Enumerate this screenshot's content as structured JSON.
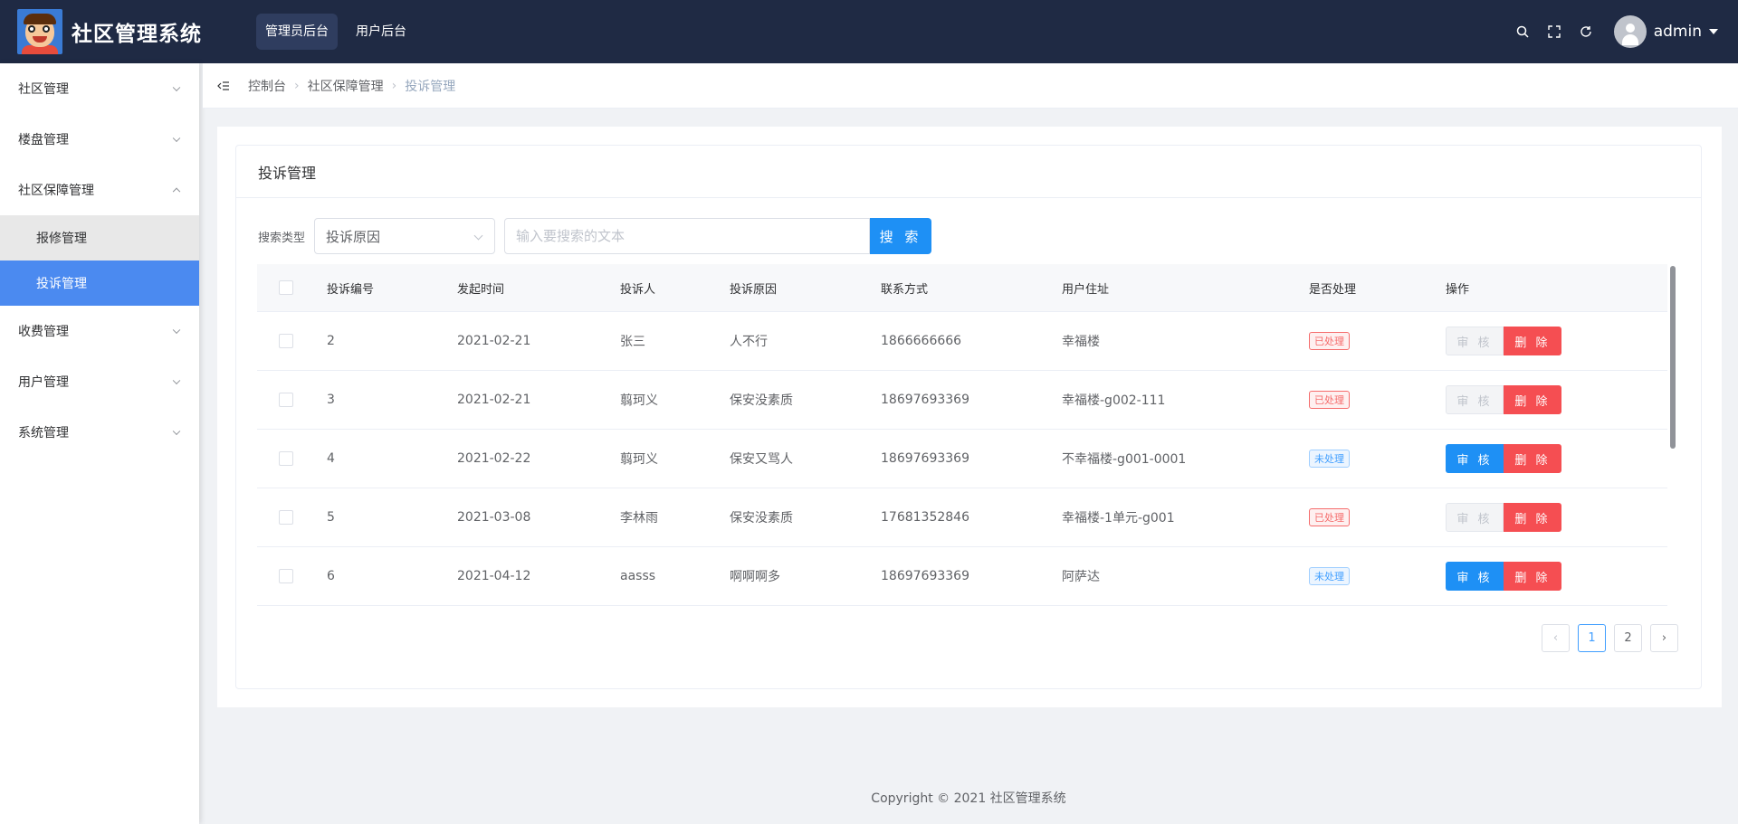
{
  "header": {
    "app_title": "社区管理系统",
    "nav": [
      {
        "label": "管理员后台",
        "active": true
      },
      {
        "label": "用户后台",
        "active": false
      }
    ],
    "tools": [
      "search-icon",
      "fullscreen-icon",
      "refresh-icon"
    ],
    "user_name": "admin",
    "background": "#1f2a44"
  },
  "sidebar": {
    "items": [
      {
        "label": "社区管理",
        "expanded": false
      },
      {
        "label": "楼盘管理",
        "expanded": false
      },
      {
        "label": "社区保障管理",
        "expanded": true,
        "children": [
          {
            "label": "报修管理",
            "active": false
          },
          {
            "label": "投诉管理",
            "active": true
          }
        ]
      },
      {
        "label": "收费管理",
        "expanded": false
      },
      {
        "label": "用户管理",
        "expanded": false
      },
      {
        "label": "系统管理",
        "expanded": false
      }
    ],
    "active_color": "#4b8af0"
  },
  "breadcrumb": [
    "控制台",
    "社区保障管理",
    "投诉管理"
  ],
  "card": {
    "title": "投诉管理"
  },
  "search": {
    "label": "搜索类型",
    "type_value": "投诉原因",
    "placeholder": "输入要搜索的文本",
    "button": "搜 索"
  },
  "table": {
    "columns": [
      "投诉编号",
      "发起时间",
      "投诉人",
      "投诉原因",
      "联系方式",
      "用户住址",
      "是否处理",
      "操作"
    ],
    "rows": [
      {
        "id": "2",
        "time": "2021-02-21",
        "user": "张三",
        "reason": "人不行",
        "phone": "1866666666",
        "address": "幸福楼",
        "status": "已处理",
        "handled": true
      },
      {
        "id": "3",
        "time": "2021-02-21",
        "user": "翦珂义",
        "reason": "保安没素质",
        "phone": "18697693369",
        "address": "幸福楼-g002-111",
        "status": "已处理",
        "handled": true
      },
      {
        "id": "4",
        "time": "2021-02-22",
        "user": "翦珂义",
        "reason": "保安又骂人",
        "phone": "18697693369",
        "address": "不幸福楼-g001-0001",
        "status": "未处理",
        "handled": false
      },
      {
        "id": "5",
        "time": "2021-03-08",
        "user": "李林雨",
        "reason": "保安没素质",
        "phone": "17681352846",
        "address": "幸福楼-1单元-g001",
        "status": "已处理",
        "handled": true
      },
      {
        "id": "6",
        "time": "2021-04-12",
        "user": "aasss",
        "reason": "啊啊啊多",
        "phone": "18697693369",
        "address": "阿萨达",
        "status": "未处理",
        "handled": false
      }
    ],
    "actions": {
      "review": "审 核",
      "delete": "删 除"
    }
  },
  "pagination": {
    "prev": "‹",
    "pages": [
      "1",
      "2"
    ],
    "current": "1",
    "next": "›"
  },
  "footer": "Copyright © 2021 社区管理系统"
}
